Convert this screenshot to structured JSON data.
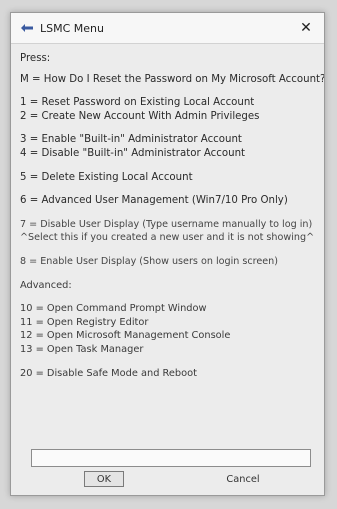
{
  "window": {
    "title": "LSMC Menu"
  },
  "menu": {
    "press": "Press:",
    "m": "M = How Do I Reset the Password on My Microsoft Account?",
    "o1": "1 = Reset Password on Existing Local Account",
    "o2": "2 = Create New Account With Admin Privileges",
    "o3": "3 = Enable \"Built-in\" Administrator Account",
    "o4": "4 = Disable \"Built-in\" Administrator Account",
    "o5": "5 = Delete Existing Local Account",
    "o6": "6 = Advanced User Management (Win7/10 Pro Only)",
    "o7": "7 = Disable User Display (Type username manually to log in)",
    "o7note": "^Select this if you created a new user and it is not showing^",
    "o8": "8 = Enable User Display (Show users on login screen)",
    "advanced": "Advanced:",
    "o10": "10 = Open Command Prompt Window",
    "o11": "11 = Open Registry Editor",
    "o12": "12 = Open Microsoft Management Console",
    "o13": "13 = Open Task Manager",
    "o20": "20 = Disable Safe Mode and Reboot"
  },
  "input": {
    "value": ""
  },
  "buttons": {
    "ok": "OK",
    "cancel": "Cancel"
  },
  "icons": {
    "app": "arrow-icon",
    "close": "close-icon"
  }
}
